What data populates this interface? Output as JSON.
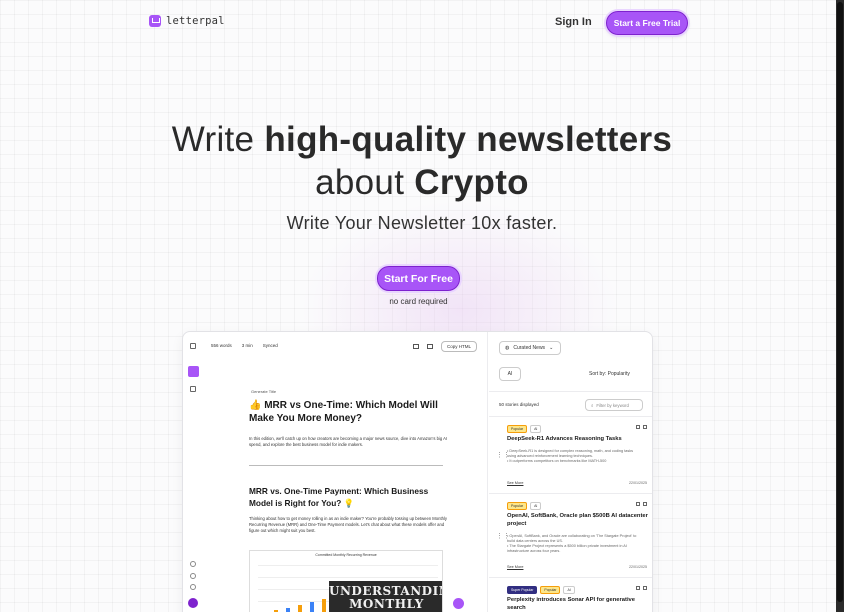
{
  "header": {
    "logo_text": "letterpal",
    "signin_label": "Sign In",
    "trial_label": "Start a Free Trial"
  },
  "hero": {
    "line1_a": "Write ",
    "line1_b": "high-quality",
    "line1_c": " newsletters",
    "line2_a": "about ",
    "line2_b": "Crypto",
    "subtitle": "Write Your Newsletter 10x faster.",
    "cta_label": "Start For Free",
    "cta_note": "no card required"
  },
  "colors": {
    "accent": "#a855f7",
    "accent_dark": "#7e22ce"
  },
  "app": {
    "toolbar": {
      "words": "556 words",
      "minutes": "3 min",
      "synced": "Synced",
      "copy_label": "Copy HTML"
    },
    "doc": {
      "generate_title": "Generate Title",
      "title": "👍 MRR vs One-Time: Which Model Will Make You More Money?",
      "intro": "In this edition, we'll catch up on how creators are becoming a major news source, dive into Amazon's big AI spend, and explore the best business model for indie makers.",
      "heading2": "MRR vs. One-Time Payment: Which Business Model is Right for You? 💡",
      "para2": "Thinking about how to get money rolling in as an indie maker? You're probably tossing up between Monthly Recurring Revenue (MRR) and One-Time Payment models. Let's chat about what these models offer and figure out which might suit you best.",
      "chart_title": "Committed Monthly Recurring Revenue",
      "overlay_text": "UNDERSTANDING MONTHLY RECURRING"
    },
    "news": {
      "source_select": "Curated News",
      "filter_chip": "AI",
      "sort_label": "Sort by: Popularity",
      "count_label": "50 stories displayed",
      "filter_placeholder": "Filter by keyword",
      "stories": [
        {
          "badges": [
            "Popular",
            "AI"
          ],
          "title": "DeepSeek-R1 Advances Reasoning Tasks",
          "bullets": [
            "DeepSeek-R1 is designed for complex reasoning, math, and coding tasks using advanced reinforcement learning techniques.",
            "It outperforms competitors on benchmarks like MATH-500"
          ],
          "more": "See More",
          "date": "22/01/2025"
        },
        {
          "badges": [
            "Popular",
            "AI"
          ],
          "title": "OpenAI, SoftBank, Oracle plan $500B AI datacenter project",
          "bullets": [
            "OpenAI, SoftBank, and Oracle are collaborating on 'The Stargate Project' to build data centers across the US.",
            "The Stargate Project represents a $500 billion private investment in AI infrastructure across four years."
          ],
          "more": "See More",
          "date": "22/01/2025"
        },
        {
          "badges": [
            "Super Popular",
            "Popular",
            "AI"
          ],
          "title": "Perplexity introduces Sonar API for generative search"
        }
      ]
    }
  }
}
